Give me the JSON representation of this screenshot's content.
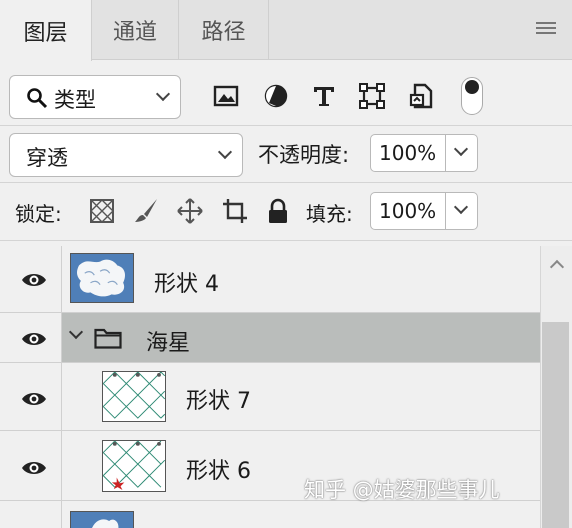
{
  "tabs": [
    {
      "label": "图层",
      "active": true
    },
    {
      "label": "通道",
      "active": false
    },
    {
      "label": "路径",
      "active": false
    }
  ],
  "filter": {
    "kind_label": "类型",
    "icons": [
      "image-filter-icon",
      "adjustment-filter-icon",
      "type-filter-icon",
      "shape-filter-icon",
      "smart-object-filter-icon",
      "filter-toggle"
    ]
  },
  "blend": {
    "mode": "穿透",
    "opacity_label": "不透明度:",
    "opacity_value": "100%"
  },
  "lock": {
    "label": "锁定:",
    "icons": [
      "lock-transparent-pixels-icon",
      "lock-image-pixels-icon",
      "lock-position-icon",
      "lock-artboard-icon",
      "lock-all-icon"
    ],
    "fill_label": "填充:",
    "fill_value": "100%"
  },
  "layers": [
    {
      "name": "形状 4",
      "type": "shape",
      "visible": true
    },
    {
      "name": "海星",
      "type": "group",
      "expanded": true,
      "visible": true
    },
    {
      "name": "形状 7",
      "type": "shape",
      "visible": true,
      "indent": 1
    },
    {
      "name": "形状 6",
      "type": "shape",
      "visible": true,
      "indent": 1
    }
  ],
  "watermark": "知乎 @姑婆那些事儿",
  "colors": {
    "group_highlight": "#babdbb",
    "thumb_blue": "#4f7fb8",
    "panel_bg": "#f0f0f0"
  }
}
